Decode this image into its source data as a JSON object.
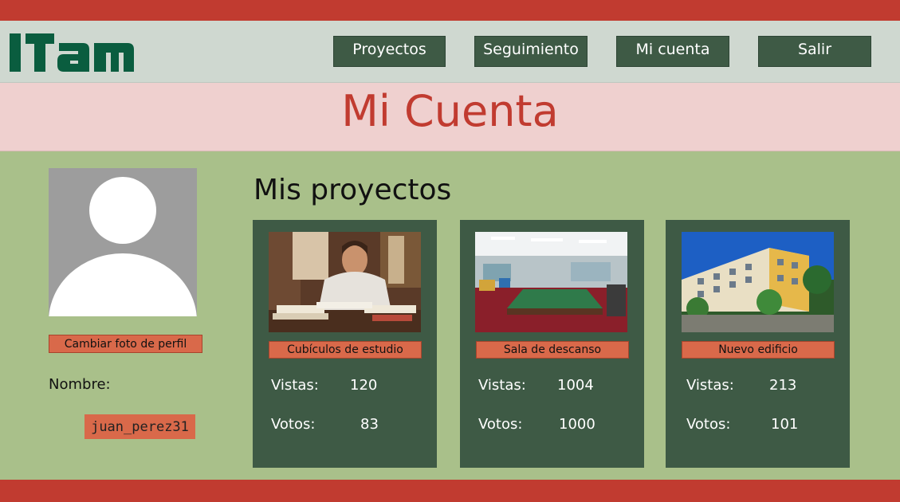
{
  "brand": {
    "logo_text": "ITAM",
    "colors": {
      "primary_red": "#c13b30",
      "dark_green": "#3e5a45",
      "page_green": "#a9c08a",
      "accent_orange": "#d9694a"
    }
  },
  "nav": {
    "items": [
      {
        "label": "Proyectos"
      },
      {
        "label": "Seguimiento"
      },
      {
        "label": "Mi cuenta"
      },
      {
        "label": "Salir"
      }
    ]
  },
  "page": {
    "title": "Mi Cuenta"
  },
  "profile": {
    "change_photo_label": "Cambiar foto de perfil",
    "name_label": "Nombre:",
    "username": "juan_perez31",
    "avatar_icon": "user-silhouette-icon"
  },
  "projects": {
    "heading": "Mis proyectos",
    "views_label": "Vistas:",
    "votes_label": "Votos:",
    "items": [
      {
        "name": "Cubículos de estudio",
        "views": "120",
        "votes": "83"
      },
      {
        "name": "Sala de descanso",
        "views": "1004",
        "votes": "1000"
      },
      {
        "name": "Nuevo edificio",
        "views": "213",
        "votes": "101"
      }
    ]
  }
}
